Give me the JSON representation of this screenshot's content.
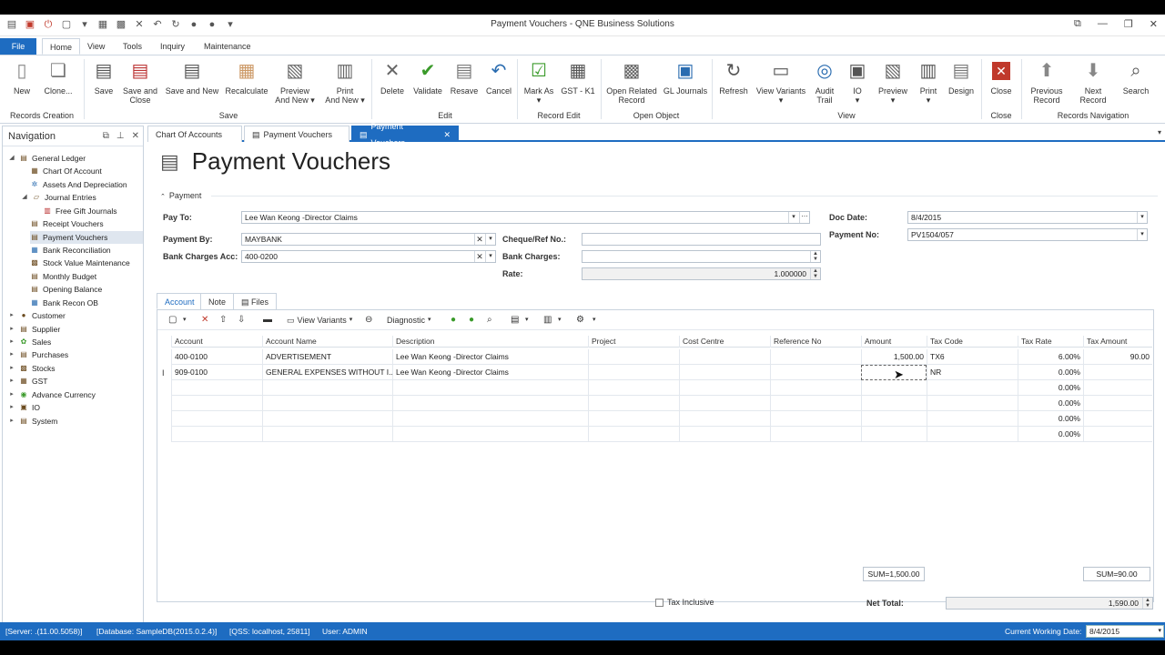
{
  "window": {
    "title": "Payment Vouchers - QNE Business Solutions"
  },
  "ribbon_tabs": [
    "File",
    "Home",
    "View",
    "Tools",
    "Inquiry",
    "Maintenance"
  ],
  "ribbon": {
    "groups": {
      "records_creation": "Records Creation",
      "save": "Save",
      "edit": "Edit",
      "record_edit": "Record Edit",
      "open_object": "Open Object",
      "view": "View",
      "close": "Close",
      "records_navigation": "Records Navigation"
    },
    "buttons": {
      "new": "New",
      "clone": "Clone...",
      "save": "Save",
      "save_and_close_1": "Save and",
      "save_and_close_2": "Close",
      "save_and_new": "Save and New",
      "recalculate": "Recalculate",
      "preview_and_new_1": "Preview",
      "preview_and_new_2": "And New",
      "print_and_new_1": "Print",
      "print_and_new_2": "And New",
      "delete": "Delete",
      "validate": "Validate",
      "resave": "Resave",
      "cancel": "Cancel",
      "mark_as": "Mark As",
      "gst_k1": "GST - K1",
      "open_related_record_1": "Open Related",
      "open_related_record_2": "Record",
      "gl_journals": "GL Journals",
      "refresh": "Refresh",
      "view_variants": "View Variants",
      "audit_trail_1": "Audit",
      "audit_trail_2": "Trail",
      "io": "IO",
      "preview": "Preview",
      "print": "Print",
      "design": "Design",
      "close": "Close",
      "previous_record_1": "Previous",
      "previous_record_2": "Record",
      "next_record": "Next Record",
      "search": "Search"
    }
  },
  "navigation": {
    "title": "Navigation",
    "items": [
      {
        "label": "General Ledger"
      },
      {
        "label": "Chart Of Account"
      },
      {
        "label": "Assets And Depreciation"
      },
      {
        "label": "Journal Entries"
      },
      {
        "label": "Free Gift Journals"
      },
      {
        "label": "Receipt Vouchers"
      },
      {
        "label": "Payment Vouchers"
      },
      {
        "label": "Bank Reconciliation"
      },
      {
        "label": "Stock Value Maintenance"
      },
      {
        "label": "Monthly Budget"
      },
      {
        "label": "Opening Balance"
      },
      {
        "label": "Bank Recon OB"
      },
      {
        "label": "Customer"
      },
      {
        "label": "Supplier"
      },
      {
        "label": "Sales"
      },
      {
        "label": "Purchases"
      },
      {
        "label": "Stocks"
      },
      {
        "label": "GST"
      },
      {
        "label": "Advance Currency"
      },
      {
        "label": "IO"
      },
      {
        "label": "System"
      }
    ]
  },
  "doc_tabs": [
    "Chart Of Accounts",
    "Payment Vouchers",
    "Payment Vouchers"
  ],
  "page": {
    "title": "Payment Vouchers",
    "section": "Payment"
  },
  "form": {
    "pay_to_label": "Pay To:",
    "pay_to_value": "Lee Wan Keong -Director Claims",
    "doc_date_label": "Doc Date:",
    "doc_date_value": "8/4/2015",
    "payment_by_label": "Payment By:",
    "payment_by_value": "MAYBANK",
    "cheque_label": "Cheque/Ref No.:",
    "cheque_value": "",
    "payment_no_label": "Payment No:",
    "payment_no_value": "PV1504/057",
    "bank_charges_acc_label": "Bank Charges Acc:",
    "bank_charges_acc_value": "400-0200",
    "bank_charges_label": "Bank Charges:",
    "bank_charges_value": "",
    "rate_label": "Rate:",
    "rate_value": "1.000000"
  },
  "subtabs": [
    "Account",
    "Note",
    "Files"
  ],
  "grid_toolbar": {
    "view_variants": "View Variants",
    "diagnostic": "Diagnostic"
  },
  "grid": {
    "columns": [
      "Account",
      "Account Name",
      "Description",
      "Project",
      "Cost Centre",
      "Reference No",
      "Amount",
      "Tax Code",
      "Tax Rate",
      "Tax Amount"
    ],
    "rows": [
      {
        "account": "400-0100",
        "account_name": "ADVERTISEMENT",
        "description": "Lee Wan Keong -Director Claims",
        "project": "",
        "cost_centre": "",
        "reference_no": "",
        "amount": "1,500.00",
        "tax_code": "TX6",
        "tax_rate": "6.00%",
        "tax_amount": "90.00"
      },
      {
        "account": "909-0100",
        "account_name": "GENERAL EXPENSES WITHOUT I...",
        "description": "Lee Wan Keong -Director Claims",
        "project": "",
        "cost_centre": "",
        "reference_no": "",
        "amount": "",
        "tax_code": "NR",
        "tax_rate": "0.00%",
        "tax_amount": ""
      },
      {
        "account": "",
        "account_name": "",
        "description": "",
        "project": "",
        "cost_centre": "",
        "reference_no": "",
        "amount": "",
        "tax_code": "",
        "tax_rate": "0.00%",
        "tax_amount": ""
      },
      {
        "account": "",
        "account_name": "",
        "description": "",
        "project": "",
        "cost_centre": "",
        "reference_no": "",
        "amount": "",
        "tax_code": "",
        "tax_rate": "0.00%",
        "tax_amount": ""
      },
      {
        "account": "",
        "account_name": "",
        "description": "",
        "project": "",
        "cost_centre": "",
        "reference_no": "",
        "amount": "",
        "tax_code": "",
        "tax_rate": "0.00%",
        "tax_amount": ""
      },
      {
        "account": "",
        "account_name": "",
        "description": "",
        "project": "",
        "cost_centre": "",
        "reference_no": "",
        "amount": "",
        "tax_code": "",
        "tax_rate": "0.00%",
        "tax_amount": ""
      }
    ],
    "sum_amount": "SUM=1,500.00",
    "sum_tax": "SUM=90.00"
  },
  "footer": {
    "tax_inclusive": "Tax Inclusive",
    "net_total_label": "Net Total:",
    "net_total_value": "1,590.00"
  },
  "statusbar": {
    "server": "[Server: .(11.00.5058)]",
    "database": "[Database: SampleDB(2015.0.2.4)]",
    "qss": "[QSS: localhost, 25811]",
    "user": "User: ADMIN",
    "working_date_label": "Current Working Date:",
    "working_date_value": "8/4/2015"
  },
  "colors": {
    "accent": "#1e6cc1"
  }
}
